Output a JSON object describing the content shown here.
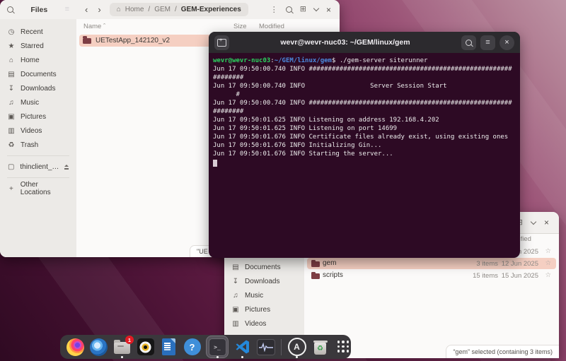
{
  "colors": {
    "selection_pink": "#f5cfc2",
    "terminal_bg": "#2d0a24",
    "prompt_green": "#2bd35f",
    "prompt_blue": "#4b8be0",
    "badge_red": "#e01b24"
  },
  "files_window_1": {
    "header": {
      "app_title": "Files",
      "back": "‹",
      "forward": "›",
      "kebab": "⋮"
    },
    "breadcrumb": {
      "home_glyph": "⌂",
      "sep": "/",
      "items": [
        "Home",
        "GEM",
        "GEM-Experiences"
      ]
    },
    "columns": {
      "name": "Name",
      "sort_caret": "ˆ",
      "size": "Size",
      "modified": "Modified"
    },
    "sidebar": {
      "items": [
        {
          "icon": "clock-icon",
          "glyph": "◷",
          "label": "Recent"
        },
        {
          "icon": "star-icon",
          "glyph": "★",
          "label": "Starred"
        },
        {
          "icon": "home-icon",
          "glyph": "⌂",
          "label": "Home"
        },
        {
          "icon": "document-icon",
          "glyph": "▤",
          "label": "Documents"
        },
        {
          "icon": "download-icon",
          "glyph": "↧",
          "label": "Downloads"
        },
        {
          "icon": "music-icon",
          "glyph": "♫",
          "label": "Music"
        },
        {
          "icon": "picture-icon",
          "glyph": "▣",
          "label": "Pictures"
        },
        {
          "icon": "video-icon",
          "glyph": "▥",
          "label": "Videos"
        },
        {
          "icon": "trash-icon",
          "glyph": "♻",
          "label": "Trash"
        }
      ],
      "mount": {
        "icon": "drive-icon",
        "glyph": "▢",
        "label": "thinclient_…"
      },
      "other_locations": {
        "plus": "+",
        "label": "Other Locations"
      }
    },
    "rows": [
      {
        "name": "UETestApp_142120_v2",
        "selected": true
      }
    ],
    "status_pill": "\"UE"
  },
  "terminal": {
    "title": "wevr@wevr-nuc03: ~/GEM/linux/gem",
    "menu_glyph": "≡",
    "close_glyph": "×",
    "prompt": {
      "user_host": "wevr@wevr-nuc03",
      "separator": ":",
      "path": "~/GEM/linux/gem",
      "command": "$ ./gem-server siterunner"
    },
    "log_lines": [
      "Jun 17 09:50:00.740 INFO #####################################################",
      "########",
      "Jun 17 09:50:00.740 INFO                 Server Session Start",
      "      #",
      "Jun 17 09:50:00.740 INFO #####################################################",
      "########",
      "Jun 17 09:50:01.625 INFO Listening on address 192.168.4.202",
      "Jun 17 09:50:01.625 INFO Listening on port 14699",
      "Jun 17 09:50:01.676 INFO Certificate files already exist, using existing ones",
      "Jun 17 09:50:01.676 INFO Initializing Gin...",
      "Jun 17 09:50:01.676 INFO Starting the server..."
    ]
  },
  "files_window_2": {
    "header": {
      "close": "×"
    },
    "columns": {
      "modified": "Modified"
    },
    "sidebar": {
      "items": [
        {
          "icon": "document-icon",
          "glyph": "▤",
          "label": "Documents"
        },
        {
          "icon": "download-icon",
          "glyph": "↧",
          "label": "Downloads"
        },
        {
          "icon": "music-icon",
          "glyph": "♫",
          "label": "Music"
        },
        {
          "icon": "picture-icon",
          "glyph": "▣",
          "label": "Pictures"
        },
        {
          "icon": "video-icon",
          "glyph": "▥",
          "label": "Videos"
        }
      ]
    },
    "star_glyph": "☆",
    "rows": [
      {
        "name": "",
        "items": "",
        "modified": "Jun 2025",
        "selected": false
      },
      {
        "name": "gem",
        "items": "3 items",
        "modified": "12 Jun 2025",
        "selected": true
      },
      {
        "name": "scripts",
        "items": "15 items",
        "modified": "15 Jun 2025",
        "selected": false
      }
    ],
    "status_pill": "“gem” selected (containing 3 items)"
  },
  "dock": {
    "items": [
      {
        "icon": "firefox-icon"
      },
      {
        "icon": "thunderbird-icon"
      },
      {
        "icon": "files-icon",
        "badge": "1",
        "running": true
      },
      {
        "icon": "rhythmbox-icon"
      },
      {
        "icon": "libreoffice-writer-icon"
      },
      {
        "icon": "help-icon"
      },
      {
        "icon": "terminal-icon",
        "glyph": ">_",
        "running": true,
        "focused": true
      },
      {
        "icon": "vscode-icon",
        "running": true
      },
      {
        "icon": "system-monitor-icon"
      },
      {
        "icon": "a-logo-icon",
        "glyph": "A",
        "running": true
      },
      {
        "icon": "trash-icon",
        "glyph": "♻"
      },
      {
        "icon": "app-grid-icon"
      }
    ]
  }
}
